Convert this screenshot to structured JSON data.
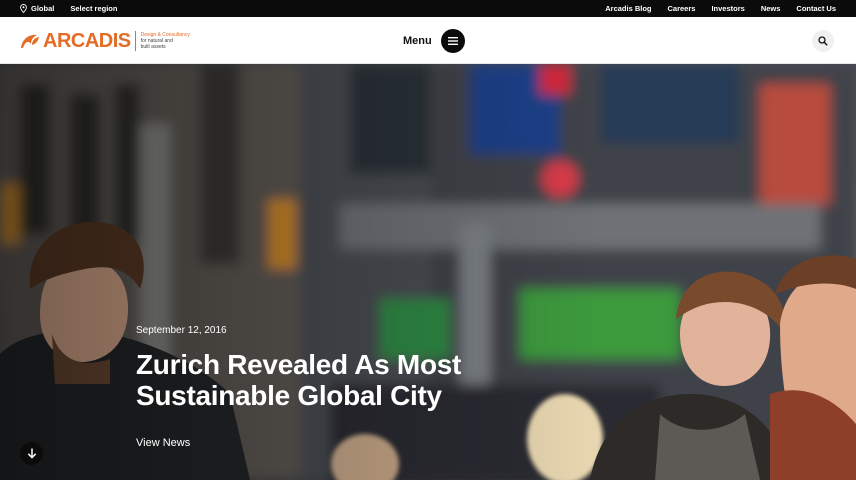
{
  "utility_bar": {
    "region_label": "Global",
    "select_region_label": "Select region",
    "links": [
      "Arcadis Blog",
      "Careers",
      "Investors",
      "News",
      "Contact Us"
    ]
  },
  "header": {
    "logo_word": "ARCADIS",
    "logo_tagline": [
      "Design & Consultancy",
      "for natural and",
      "built assets"
    ],
    "menu_label": "Menu"
  },
  "hero": {
    "date": "September 12, 2016",
    "title": "Zurich Revealed As Most Sustainable Global City",
    "link_label": "View News"
  },
  "icons": {
    "region": "map-pin-icon",
    "menu": "hamburger-icon",
    "search": "search-icon",
    "scroll": "arrow-down-icon"
  },
  "colors": {
    "brand": "#e46c25",
    "dark": "#0b0b0b"
  }
}
